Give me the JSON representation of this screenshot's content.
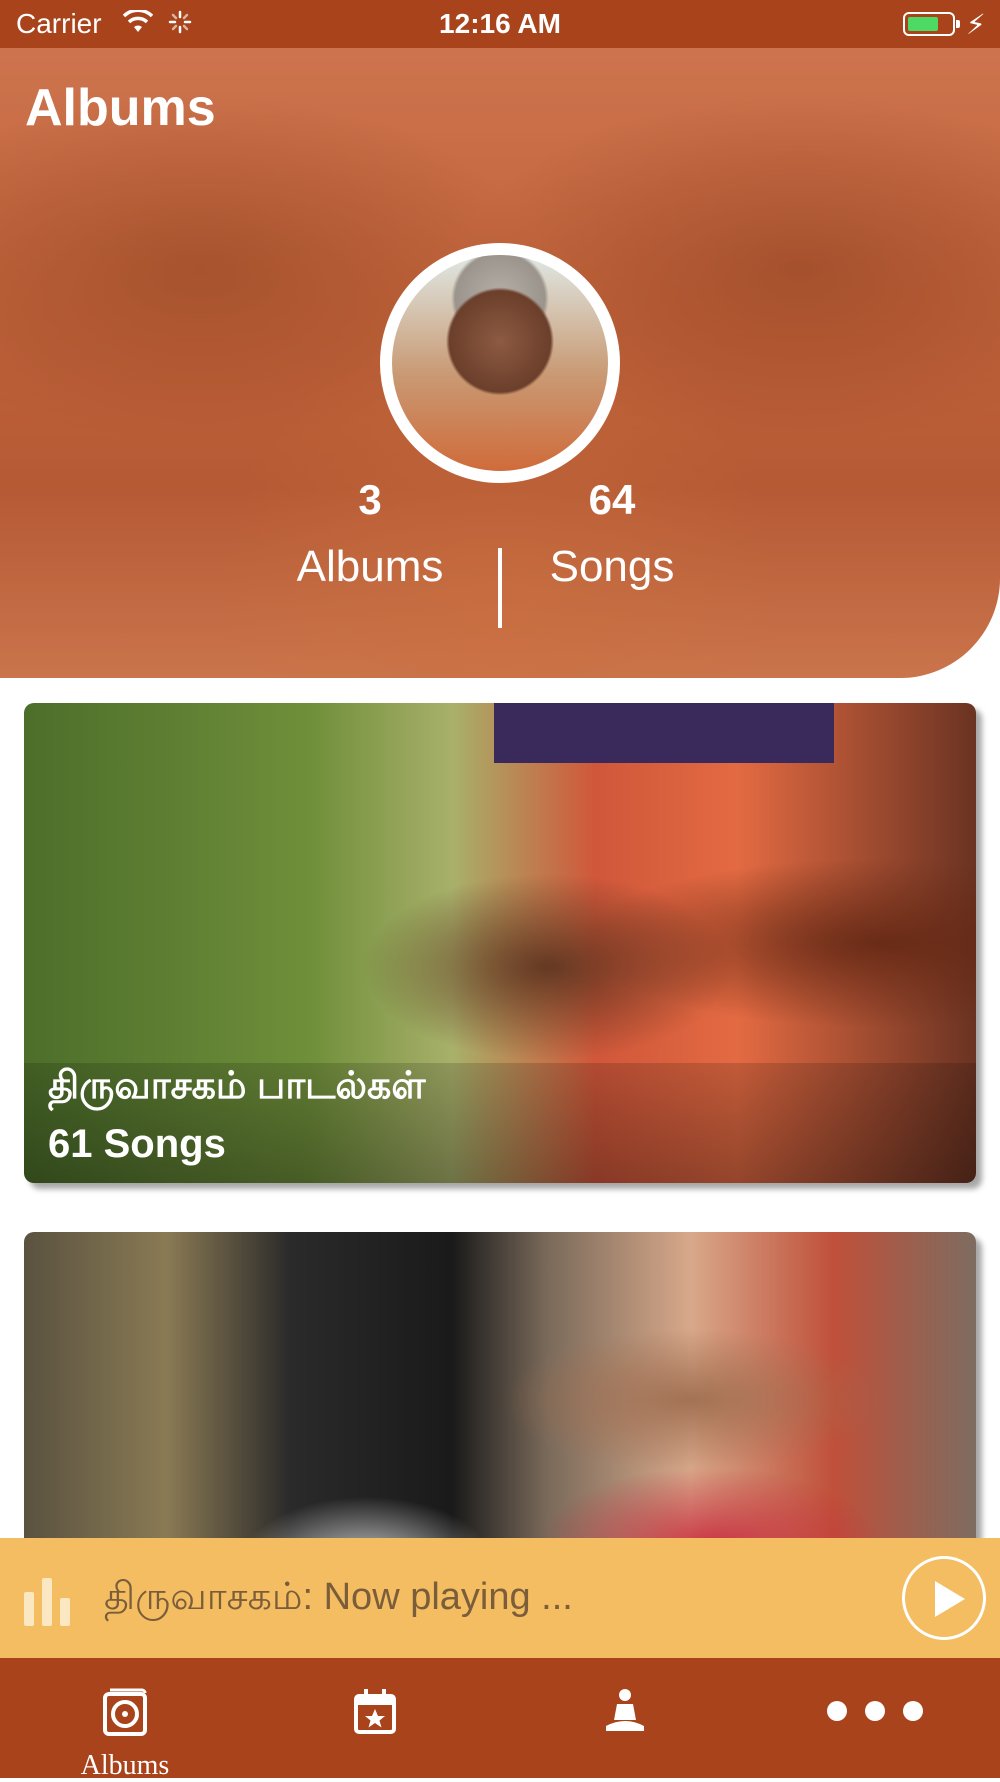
{
  "status_bar": {
    "carrier": "Carrier",
    "time": "12:16 AM"
  },
  "header": {
    "title": "Albums",
    "stats": {
      "albums_count": "3",
      "albums_label": "Albums",
      "songs_count": "64",
      "songs_label": "Songs"
    }
  },
  "albums": [
    {
      "title": "திருவாசகம் பாடல்கள்",
      "count": "61 Songs"
    },
    {
      "title": "",
      "count": ""
    }
  ],
  "now_playing": {
    "text": "திருவாசகம்: Now playing ..."
  },
  "tab_bar": {
    "tabs": [
      {
        "label": "Albums",
        "icon": "album-icon",
        "selected": true
      },
      {
        "label": "",
        "icon": "calendar-star-icon",
        "selected": false
      },
      {
        "label": "",
        "icon": "meditation-icon",
        "selected": false
      },
      {
        "label": "",
        "icon": "more-icon",
        "selected": false
      }
    ]
  },
  "colors": {
    "primary": "#a8431b",
    "now_playing_bg": "#f4bd61",
    "battery": "#4cd964"
  }
}
